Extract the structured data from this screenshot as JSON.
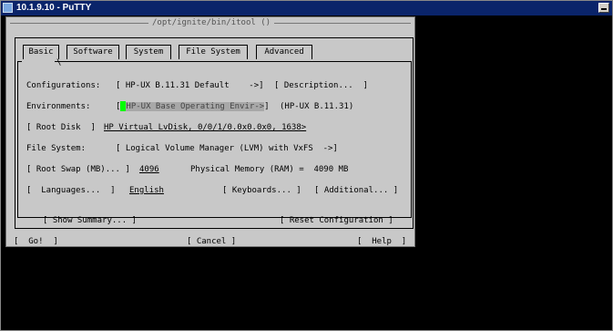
{
  "window": {
    "title": "10.1.9.10 - PuTTY"
  },
  "terminal": {
    "path_title": "/opt/ignite/bin/itool ()"
  },
  "tabs": [
    "Basic",
    "Software",
    "System",
    "File System",
    "Advanced"
  ],
  "rows": {
    "configurations_label": "Configurations:",
    "configurations_value": "[ HP-UX B.11.31 Default    ->]",
    "description_button": "[ Description...  ]",
    "environments_label": "Environments:",
    "environments_value": "HP-UX Base Operating Envir",
    "environments_arrow": "->",
    "environments_note": "(HP-UX B.11.31)",
    "root_disk_button": "[ Root Disk  ]",
    "root_disk_value": "HP Virtual LvDisk, 0/0/1/0.0x0.0x0, 1638>",
    "file_system_label": "File System:",
    "file_system_value": "[ Logical Volume Manager (LVM) with VxFS  ->]",
    "root_swap_button": "[ Root Swap (MB)... ]",
    "root_swap_value": "4096",
    "physical_memory_label": "Physical Memory (RAM) =  4090 MB",
    "languages_button": "[  Languages...  ]",
    "language_value": "English",
    "keyboards_button": "[ Keyboards... ]",
    "additional_button": "[ Additional... ]"
  },
  "bottom": {
    "show_summary": "[ Show Summary... ]",
    "reset_configuration": "[ Reset Configuration ]",
    "go": "[  Go!  ]",
    "cancel": "[ Cancel ]",
    "help": "[  Help  ]"
  }
}
